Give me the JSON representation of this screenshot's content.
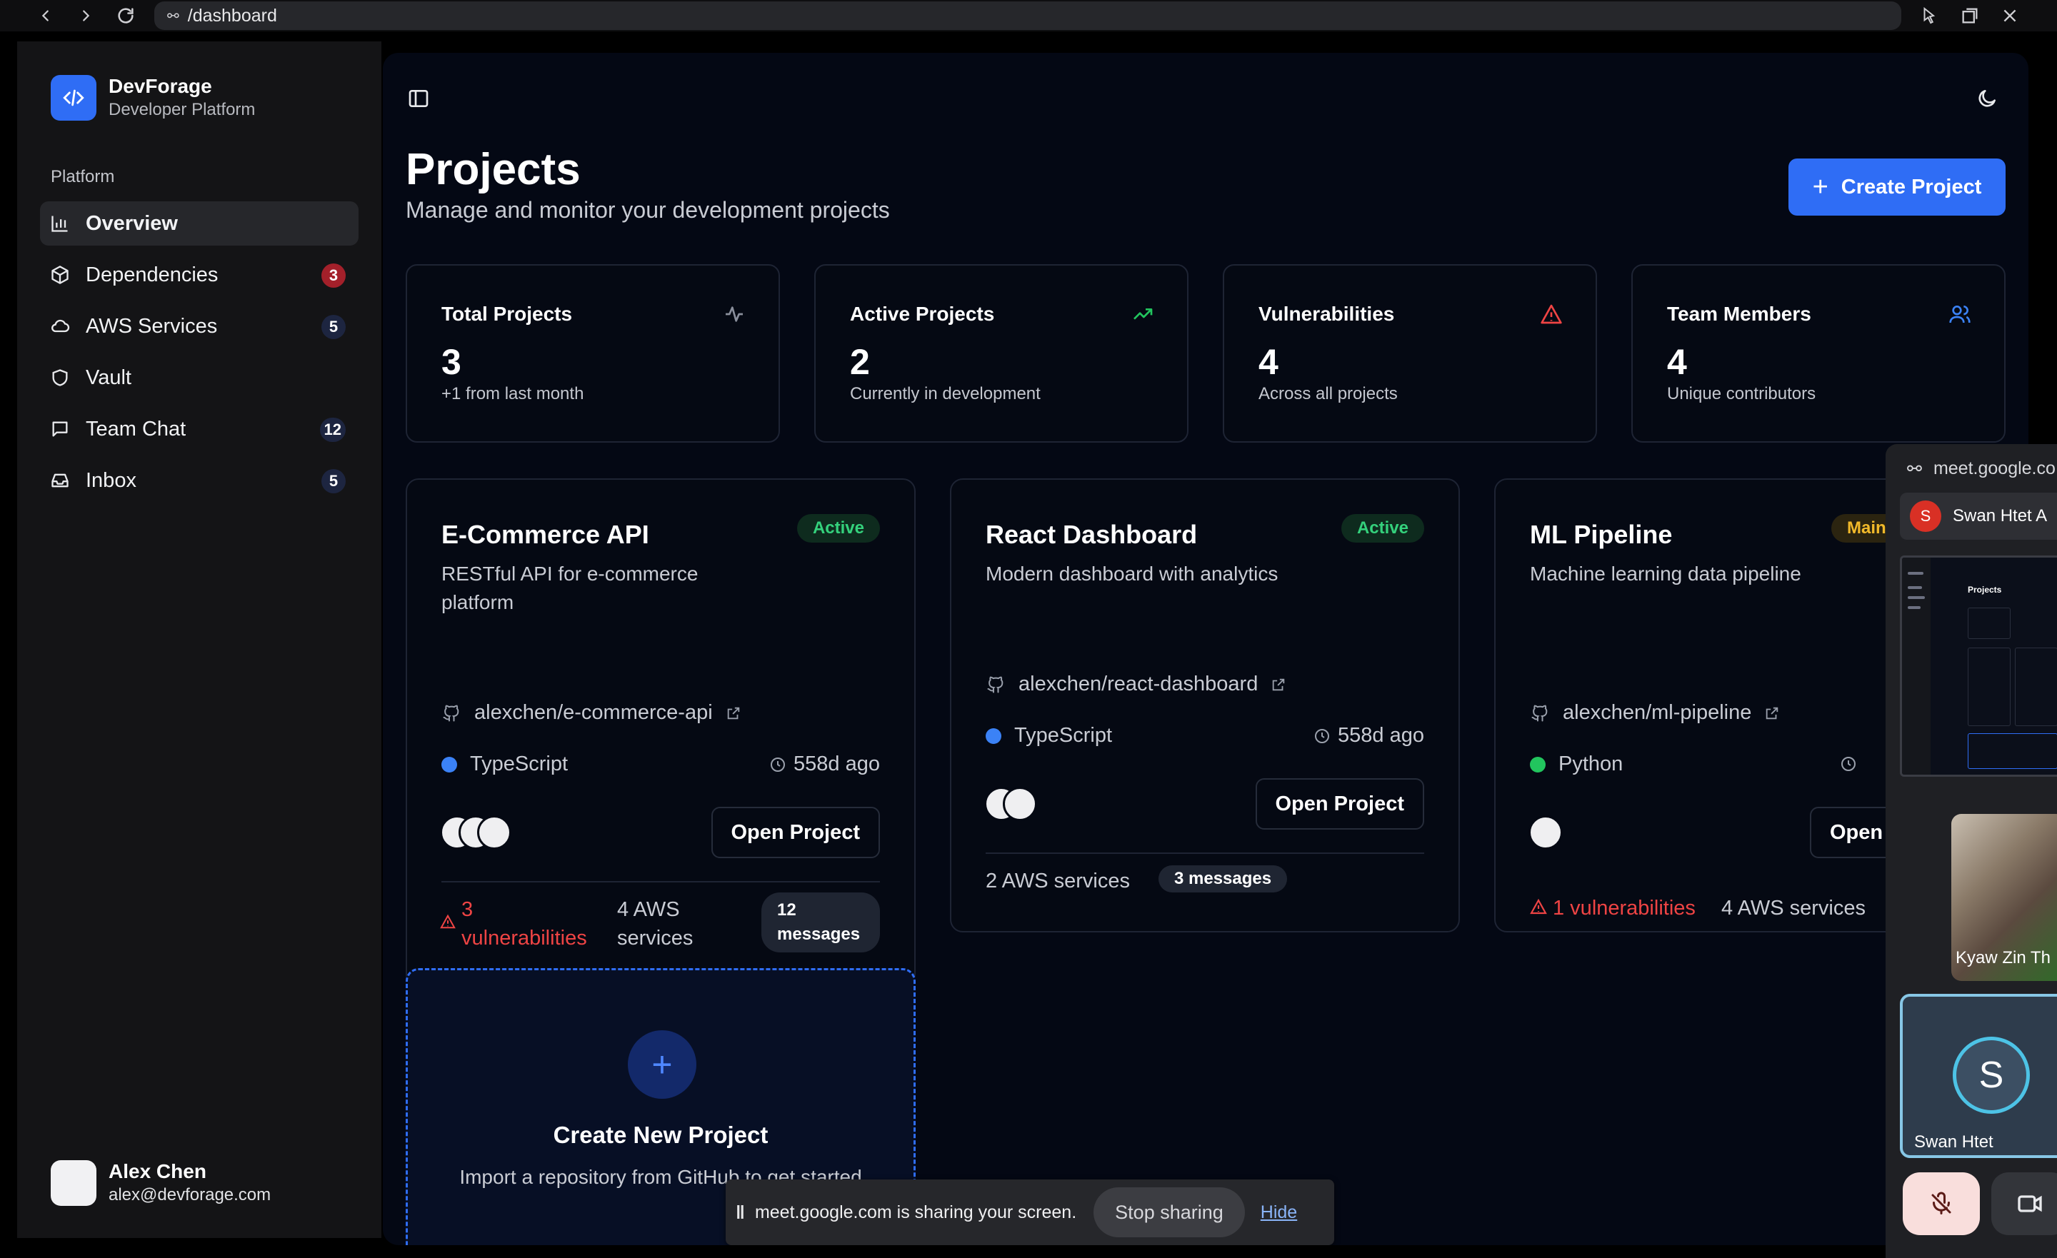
{
  "browser": {
    "url": "/dashboard"
  },
  "sidebar": {
    "brand_name": "DevForage",
    "brand_sub": "Developer Platform",
    "group_label": "Platform",
    "items": [
      {
        "label": "Overview",
        "icon": "bar-chart-icon",
        "badge": ""
      },
      {
        "label": "Dependencies",
        "icon": "package-icon",
        "badge": "3"
      },
      {
        "label": "AWS Services",
        "icon": "cloud-icon",
        "badge": "5"
      },
      {
        "label": "Vault",
        "icon": "shield-icon",
        "badge": ""
      },
      {
        "label": "Team Chat",
        "icon": "chat-icon",
        "badge": "12"
      },
      {
        "label": "Inbox",
        "icon": "inbox-icon",
        "badge": "5"
      }
    ],
    "user_name": "Alex Chen",
    "user_email": "alex@devforage.com"
  },
  "header": {
    "title": "Projects",
    "subtitle": "Manage and monitor your development projects",
    "create_label": "Create Project"
  },
  "stats": [
    {
      "title": "Total Projects",
      "value": "3",
      "sub": "+1 from last month",
      "icon": "activity-icon",
      "color": "#8a8f9c"
    },
    {
      "title": "Active Projects",
      "value": "2",
      "sub": "Currently in development",
      "icon": "trending-up-icon",
      "color": "#22c55e"
    },
    {
      "title": "Vulnerabilities",
      "value": "4",
      "sub": "Across all projects",
      "icon": "alert-triangle-icon",
      "color": "#ef4444"
    },
    {
      "title": "Team Members",
      "value": "4",
      "sub": "Unique contributors",
      "icon": "users-icon",
      "color": "#3b82f6"
    }
  ],
  "projects": [
    {
      "name": "E-Commerce API",
      "status": "Active",
      "desc": "RESTful API for e-commerce platform",
      "repo": "alexchen/e-commerce-api",
      "lang": "TypeScript",
      "lang_color": "#3b82f6",
      "updated": "558d ago",
      "open_label": "Open Project",
      "vulns_count": "3",
      "vulns_label": "vulnerabilities",
      "aws": "4 AWS services",
      "messages": "12 messages"
    },
    {
      "name": "React Dashboard",
      "status": "Active",
      "desc": "Modern dashboard with analytics",
      "repo": "alexchen/react-dashboard",
      "lang": "TypeScript",
      "lang_color": "#3b82f6",
      "updated": "558d ago",
      "open_label": "Open Project",
      "aws": "2 AWS services",
      "messages": "3 messages"
    },
    {
      "name": "ML Pipeline",
      "status": "Main",
      "desc": "Machine learning data pipeline",
      "repo": "alexchen/ml-pipeline",
      "lang": "Python",
      "lang_color": "#22c55e",
      "open_label": "Open",
      "vulns": "1 vulnerabilities",
      "aws": "4 AWS services"
    }
  ],
  "new_project": {
    "title": "Create New Project",
    "sub": "Import a repository from GitHub to get started"
  },
  "share_bar": {
    "text": "meet.google.com is sharing your screen.",
    "stop_label": "Stop sharing",
    "hide_label": "Hide"
  },
  "meet": {
    "url": "meet.google.co",
    "user_initial": "S",
    "user_label": "Swan Htet A",
    "thumb_title": "Projects",
    "video_name": "Kyaw Zin Th",
    "self_initial": "S",
    "self_name": "Swan Htet"
  }
}
